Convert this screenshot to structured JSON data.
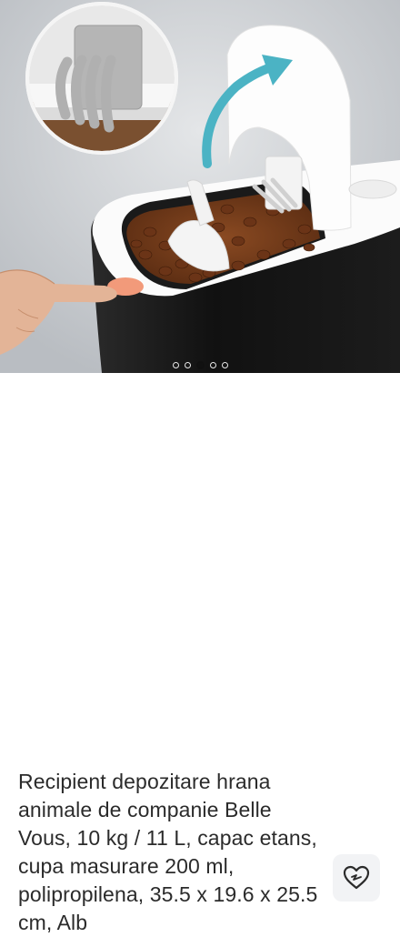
{
  "product": {
    "title": "Recipient depozitare hrana animale de companie Belle Vous, 10 kg / 11 L, capac etans, cupa masurare 200 ml, polipropilena, 35.5 x 19.6 x 25.5 cm, Alb",
    "favorite_icon": "heart-outline-icon"
  },
  "gallery": {
    "dots_count": 5,
    "active_index": 2
  },
  "colors": {
    "title": "#2b2b2b",
    "favorite_bg": "#f2f3f5",
    "arrow_accent": "#4bb3c4",
    "container_body": "#141414",
    "button_accent": "#f29a7a"
  }
}
